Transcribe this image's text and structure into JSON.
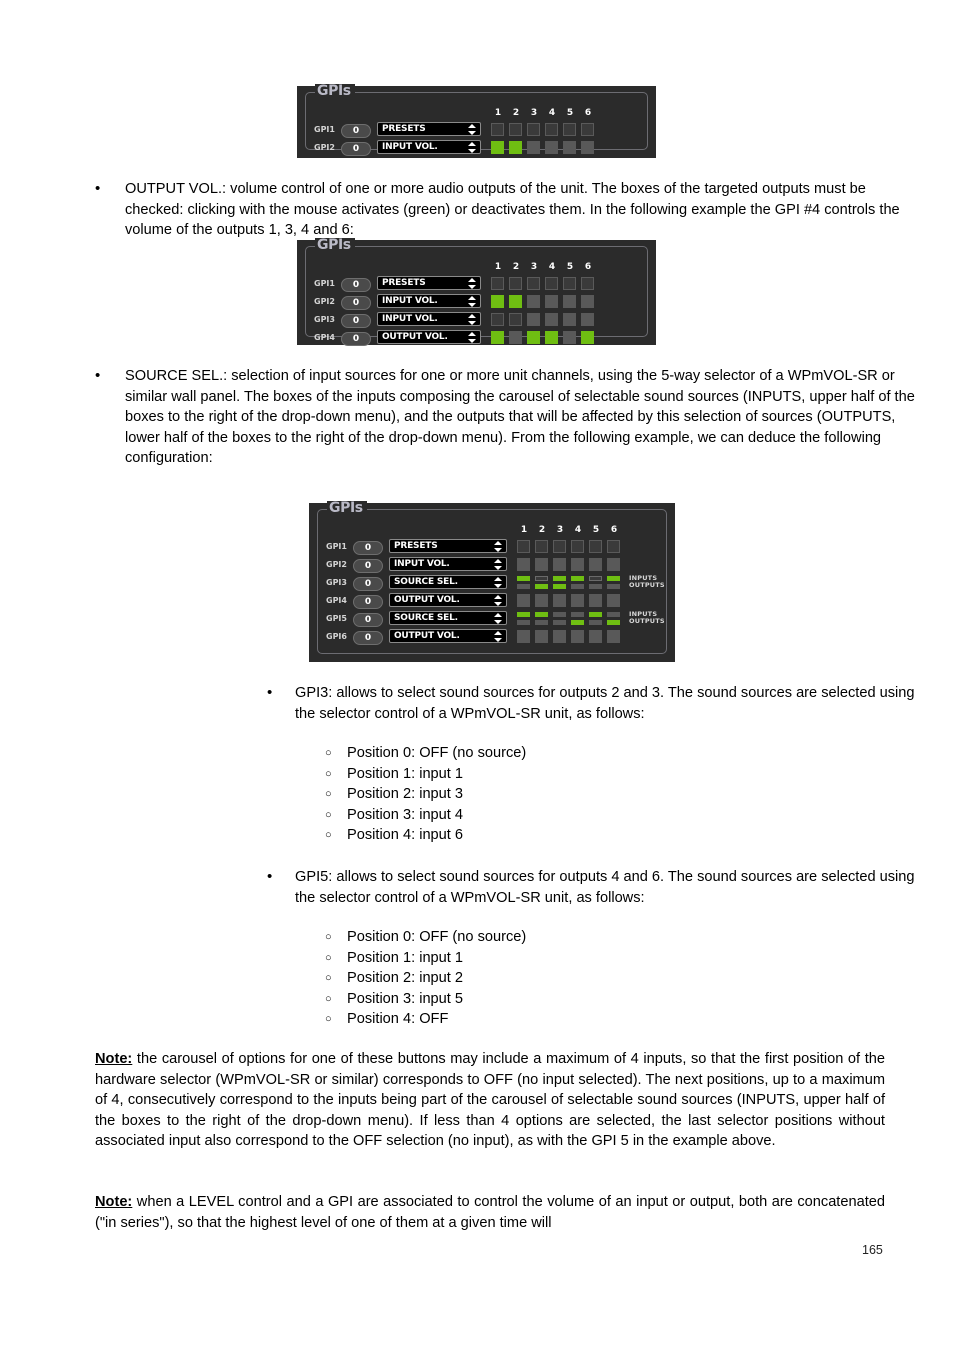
{
  "page": {
    "number": "165"
  },
  "panels": [
    {
      "id": "panel-1",
      "title": "GPIs",
      "column_headers": [
        "1",
        "2",
        "3",
        "4",
        "5",
        "6"
      ],
      "rows": [
        {
          "label": "GPI1",
          "value": "0",
          "mode": "PRESETS",
          "cell_type": "single",
          "cells": [
            "off",
            "off",
            "off",
            "off",
            "off",
            "off"
          ],
          "io_labels": null
        },
        {
          "label": "GPI2",
          "value": "0",
          "mode": "INPUT VOL.",
          "cell_type": "single",
          "cells": [
            "green",
            "green",
            "gray",
            "gray",
            "gray",
            "gray"
          ],
          "io_labels": null
        }
      ]
    },
    {
      "id": "panel-2",
      "title": "GPIs",
      "column_headers": [
        "1",
        "2",
        "3",
        "4",
        "5",
        "6"
      ],
      "rows": [
        {
          "label": "GPI1",
          "value": "0",
          "mode": "PRESETS",
          "cell_type": "single",
          "cells": [
            "off",
            "off",
            "off",
            "off",
            "off",
            "off"
          ],
          "io_labels": null
        },
        {
          "label": "GPI2",
          "value": "0",
          "mode": "INPUT VOL.",
          "cell_type": "single",
          "cells": [
            "green",
            "green",
            "gray",
            "gray",
            "gray",
            "gray"
          ],
          "io_labels": null
        },
        {
          "label": "GPI3",
          "value": "0",
          "mode": "INPUT VOL.",
          "cell_type": "single",
          "cells": [
            "off",
            "off",
            "gray",
            "gray",
            "gray",
            "gray"
          ],
          "io_labels": null
        },
        {
          "label": "GPI4",
          "value": "0",
          "mode": "OUTPUT VOL.",
          "cell_type": "single",
          "cells": [
            "green",
            "gray",
            "green",
            "green",
            "gray",
            "green"
          ],
          "io_labels": null
        }
      ]
    },
    {
      "id": "panel-3",
      "title": "GPIs",
      "column_headers": [
        "1",
        "2",
        "3",
        "4",
        "5",
        "6"
      ],
      "rows": [
        {
          "label": "GPI1",
          "value": "0",
          "mode": "PRESETS",
          "cell_type": "single",
          "cells": [
            "off",
            "off",
            "off",
            "off",
            "off",
            "off"
          ],
          "io_labels": null
        },
        {
          "label": "GPI2",
          "value": "0",
          "mode": "INPUT VOL.",
          "cell_type": "single",
          "cells": [
            "gray",
            "gray",
            "gray",
            "gray",
            "gray",
            "gray"
          ],
          "io_labels": null
        },
        {
          "label": "GPI3",
          "value": "0",
          "mode": "SOURCE SEL.",
          "cell_type": "split",
          "inputs": [
            "green",
            "off",
            "green",
            "green",
            "off",
            "green"
          ],
          "outputs": [
            "gray",
            "green",
            "green",
            "gray",
            "gray",
            "gray"
          ],
          "io_labels": {
            "top": "INPUTS",
            "bottom": "OUTPUTS"
          }
        },
        {
          "label": "GPI4",
          "value": "0",
          "mode": "OUTPUT VOL.",
          "cell_type": "single",
          "cells": [
            "gray",
            "gray",
            "gray",
            "gray",
            "gray",
            "gray"
          ],
          "io_labels": null
        },
        {
          "label": "GPI5",
          "value": "0",
          "mode": "SOURCE SEL.",
          "cell_type": "split",
          "inputs": [
            "green",
            "green",
            "gray",
            "gray",
            "green",
            "gray"
          ],
          "outputs": [
            "gray",
            "gray",
            "gray",
            "green",
            "gray",
            "green"
          ],
          "io_labels": {
            "top": "INPUTS",
            "bottom": "OUTPUTS"
          }
        },
        {
          "label": "GPI6",
          "value": "0",
          "mode": "OUTPUT VOL.",
          "cell_type": "single",
          "cells": [
            "gray",
            "gray",
            "gray",
            "gray",
            "gray",
            "gray"
          ],
          "io_labels": null
        }
      ]
    }
  ],
  "body": {
    "bullet_output_vol": "OUTPUT VOL.: volume control of one or more audio outputs of the unit. The boxes of the targeted outputs must be checked: clicking with the mouse activates (green) or deactivates them. In the following example the GPI #4 controls the volume of the outputs 1, 3, 4 and 6:",
    "bullet_source_sel": "SOURCE SEL.: selection of input sources for one or more unit channels, using the 5-way selector of a WPmVOL-SR or similar wall panel. The boxes of the inputs composing the carousel of selectable sound sources (INPUTS, upper half of the boxes to the right of the drop-down menu), and the outputs that will be affected by this selection of sources (OUTPUTS, lower half of the boxes to the right of the drop-down menu). From the following example, we can deduce the following configuration:",
    "gpi3_intro": "GPI3: allows to select sound sources for outputs 2 and 3. The sound sources are selected using the selector control of a WPmVOL-SR unit, as follows:",
    "gpi3_positions": [
      "Position 0: OFF (no source)",
      "Position 1: input 1",
      "Position 2: input 3",
      "Position 3: input 4",
      "Position 4: input 6"
    ],
    "gpi5_intro": "GPI5: allows to select sound sources for outputs 4 and 6. The sound sources are selected using the selector control of a WPmVOL-SR unit, as follows:",
    "gpi5_positions": [
      "Position 0: OFF (no source)",
      "Position 1: input 1",
      "Position 2: input 2",
      "Position 3: input 5",
      "Position 4: OFF"
    ],
    "note1_label": "Note:",
    "note1_text": " the carousel of options for one of these buttons may include a maximum of 4 inputs, so that the first position of the hardware selector (WPmVOL-SR or similar) corresponds to OFF (no input selected). The next positions, up to a maximum of 4, consecutively correspond to the inputs being part of the carousel of selectable sound sources (INPUTS, upper half of the boxes to the right of the drop-down menu). If less than 4 options are selected, the last selector positions without associated input also correspond to the OFF selection (no input), as with the GPI 5 in the example above.",
    "note2_label": "Note:",
    "note2_text": " when a LEVEL control and a GPI are associated to control the volume of an input or output, both are concatenated (\"in series\"), so that the highest level of one of them at a given time will",
    "bullet_glyph": "•",
    "circle_glyph": "○"
  }
}
